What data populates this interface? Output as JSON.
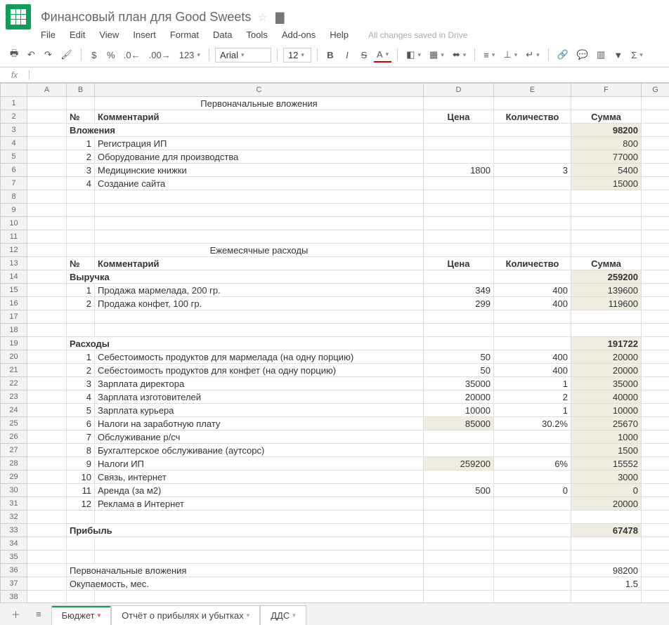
{
  "doc_title": "Финансовый план для Good Sweets",
  "saved_msg": "All changes saved in Drive",
  "menubar": [
    "File",
    "Edit",
    "View",
    "Insert",
    "Format",
    "Data",
    "Tools",
    "Add-ons",
    "Help"
  ],
  "font": "Arial",
  "font_size": "12",
  "format_num": "123",
  "cols": [
    "",
    "A",
    "B",
    "C",
    "D",
    "E",
    "F",
    "G"
  ],
  "rows": [
    {
      "n": 1,
      "C": "Первоначальные вложения",
      "c_ctr": true
    },
    {
      "n": 2,
      "B": "№",
      "C": "Комментарий",
      "D": "Цена",
      "E": "Количество",
      "F": "Сумма",
      "bold": true,
      "d_ctr": true,
      "e_ctr": true,
      "f_ctr": true
    },
    {
      "n": 3,
      "B": "Вложения",
      "B_span": true,
      "F": "98200",
      "bold": true,
      "f_calc": true
    },
    {
      "n": 4,
      "B": "1",
      "C": "Регистрация ИП",
      "F": "800",
      "f_calc": true,
      "b_num": true
    },
    {
      "n": 5,
      "B": "2",
      "C": "Оборудование для производства",
      "F": "77000",
      "f_calc": true,
      "b_num": true
    },
    {
      "n": 6,
      "B": "3",
      "C": "Медицинские книжки",
      "D": "1800",
      "E": "3",
      "F": "5400",
      "f_calc": true,
      "b_num": true
    },
    {
      "n": 7,
      "B": "4",
      "C": "Создание сайта",
      "F": "15000",
      "f_calc": true,
      "b_num": true
    },
    {
      "n": 8
    },
    {
      "n": 9
    },
    {
      "n": 10
    },
    {
      "n": 11
    },
    {
      "n": 12,
      "C": "Ежемесячные расходы",
      "c_ctr": true
    },
    {
      "n": 13,
      "B": "№",
      "C": "Комментарий",
      "D": "Цена",
      "E": "Количество",
      "F": "Сумма",
      "bold": true,
      "d_ctr": true,
      "e_ctr": true,
      "f_ctr": true
    },
    {
      "n": 14,
      "B": "Выручка",
      "B_span": true,
      "F": "259200",
      "bold": true,
      "f_calc": true,
      "sel": true
    },
    {
      "n": 15,
      "B": "1",
      "C": "Продажа мармелада, 200 гр.",
      "D": "349",
      "E": "400",
      "F": "139600",
      "f_calc": true,
      "b_num": true
    },
    {
      "n": 16,
      "B": "2",
      "C": "Продажа конфет, 100 гр.",
      "D": "299",
      "E": "400",
      "F": "119600",
      "f_calc": true,
      "b_num": true
    },
    {
      "n": 17
    },
    {
      "n": 18
    },
    {
      "n": 19,
      "B": "Расходы",
      "B_span": true,
      "F": "191722",
      "bold": true,
      "f_calc": true
    },
    {
      "n": 20,
      "B": "1",
      "C": "Себестоимость продуктов для мармелада (на одну порцию)",
      "D": "50",
      "E": "400",
      "F": "20000",
      "f_calc": true,
      "b_num": true
    },
    {
      "n": 21,
      "B": "2",
      "C": "Себестоимость продуктов для конфет (на одну порцию)",
      "D": "50",
      "E": "400",
      "F": "20000",
      "f_calc": true,
      "b_num": true
    },
    {
      "n": 22,
      "B": "3",
      "C": "Зарплата директора",
      "D": "35000",
      "E": "1",
      "F": "35000",
      "f_calc": true,
      "b_num": true
    },
    {
      "n": 23,
      "B": "4",
      "C": "Зарплата изготовителей",
      "D": "20000",
      "E": "2",
      "F": "40000",
      "f_calc": true,
      "b_num": true
    },
    {
      "n": 24,
      "B": "5",
      "C": "Зарплата курьера",
      "D": "10000",
      "E": "1",
      "F": "10000",
      "f_calc": true,
      "b_num": true
    },
    {
      "n": 25,
      "B": "6",
      "C": "Налоги на заработную плату",
      "D": "85000",
      "E": "30.2%",
      "F": "25670",
      "d_calc": true,
      "f_calc": true,
      "b_num": true
    },
    {
      "n": 26,
      "B": "7",
      "C": "Обслуживание р/сч",
      "F": "1000",
      "f_calc": true,
      "b_num": true
    },
    {
      "n": 27,
      "B": "8",
      "C": "Бухгалтерское обслуживание (аутсорс)",
      "F": "1500",
      "f_calc": true,
      "b_num": true
    },
    {
      "n": 28,
      "B": "9",
      "C": "Налоги ИП",
      "D": "259200",
      "E": "6%",
      "F": "15552",
      "d_calc": true,
      "f_calc": true,
      "b_num": true
    },
    {
      "n": 29,
      "B": "10",
      "C": "Связь, интернет",
      "F": "3000",
      "f_calc": true,
      "b_num": true
    },
    {
      "n": 30,
      "B": "11",
      "C": "Аренда (за м2)",
      "D": "500",
      "E": "0",
      "F": "0",
      "f_calc": true,
      "b_num": true
    },
    {
      "n": 31,
      "B": "12",
      "C": "Реклама в Интернет",
      "F": "20000",
      "f_calc": true,
      "b_num": true
    },
    {
      "n": 32
    },
    {
      "n": 33,
      "B": "Прибыль",
      "B_span": true,
      "F": "67478",
      "bold": true,
      "f_calc": true
    },
    {
      "n": 34
    },
    {
      "n": 35
    },
    {
      "n": 36,
      "B": "Первоначальные вложения",
      "B_span": true,
      "F": "98200"
    },
    {
      "n": 37,
      "B": "Окупаемость, мес.",
      "B_span": true,
      "F": "1.5"
    },
    {
      "n": 38
    }
  ],
  "sheet_tabs": [
    "Бюджет",
    "Отчёт о прибылях и убытках",
    "ДДС"
  ],
  "active_tab": 0,
  "fx_label": "fx"
}
